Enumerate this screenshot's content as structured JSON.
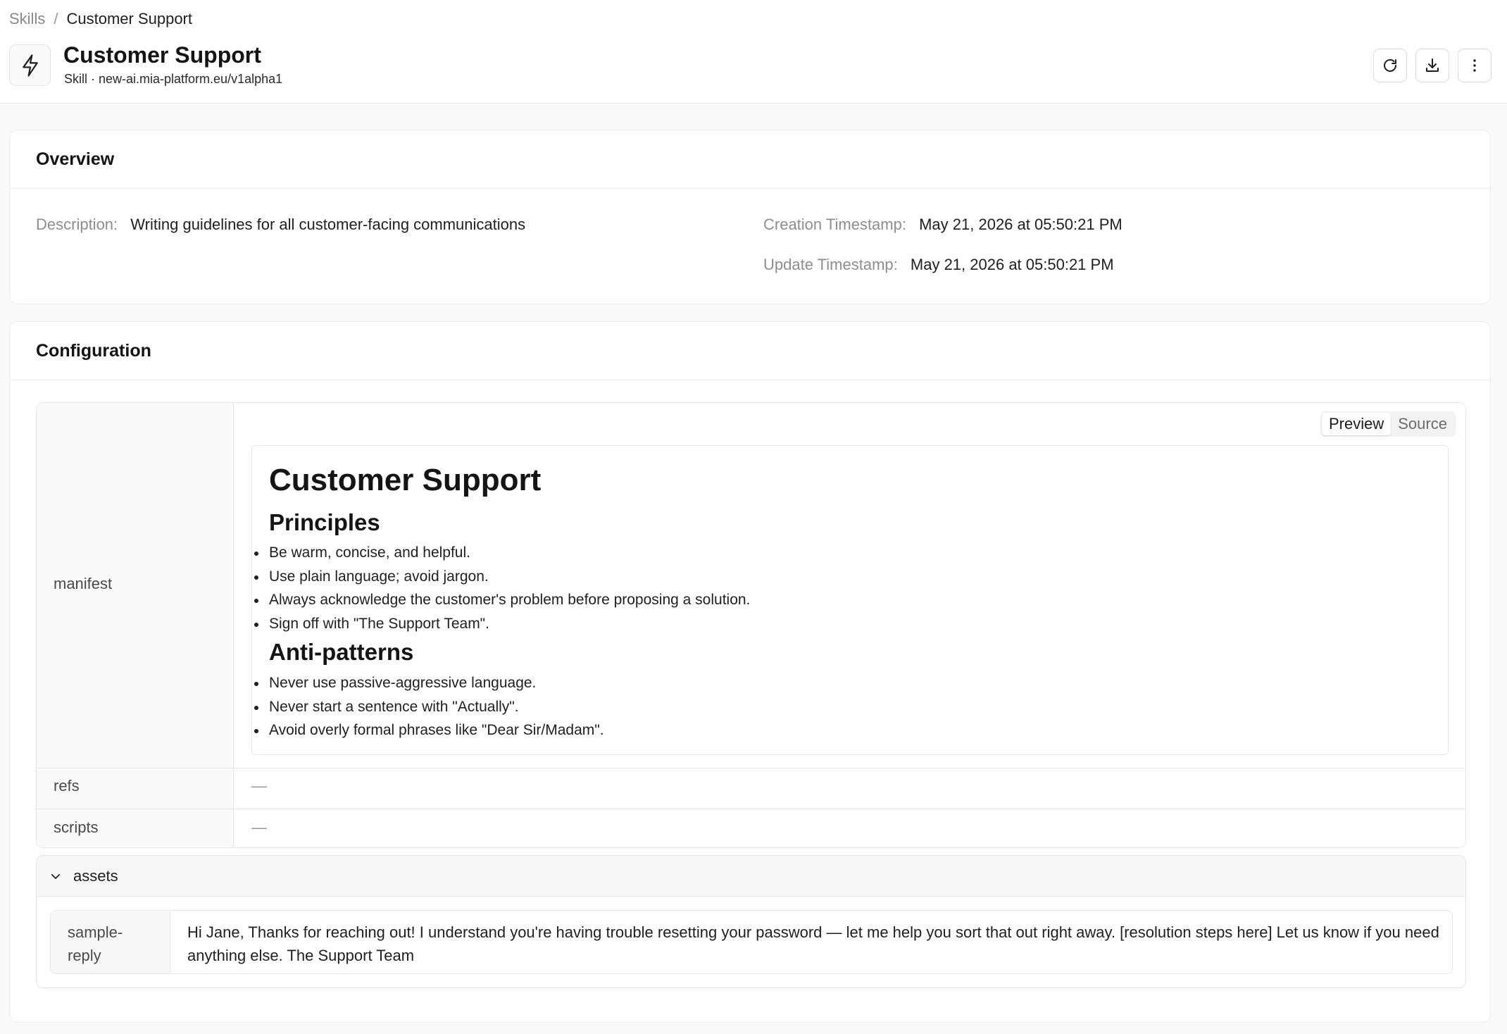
{
  "breadcrumb": {
    "root": "Skills",
    "separator": "/",
    "current": "Customer Support"
  },
  "header": {
    "icon": "lightning-bolt-icon",
    "title": "Customer Support",
    "subtitle": "Skill · new-ai.mia-platform.eu/v1alpha1",
    "actions": [
      "refresh-icon",
      "download-icon",
      "more-vertical-icon"
    ]
  },
  "overview": {
    "title": "Overview",
    "description_label": "Description",
    "description_value": "Writing guidelines for all customer-facing communications",
    "created_label": "Creation Timestamp",
    "created_value": "May 21, 2026 at 05:50:21 PM",
    "updated_label": "Update Timestamp",
    "updated_value": "May 21, 2026 at 05:50:21 PM"
  },
  "configuration": {
    "title": "Configuration",
    "rows": {
      "manifest": "manifest",
      "refs": "refs",
      "scripts": "scripts"
    },
    "empty_value": "—",
    "view_toggle": {
      "preview": "Preview",
      "source": "Source",
      "selected": "Preview"
    },
    "manifest_preview": {
      "h1": "Customer Support",
      "sections": [
        {
          "heading": "Principles",
          "items": [
            "Be warm, concise, and helpful.",
            "Use plain language; avoid jargon.",
            "Always acknowledge the customer's problem before proposing a solution.",
            "Sign off with \"The Support Team\"."
          ]
        },
        {
          "heading": "Anti-patterns",
          "items": [
            "Never use passive-aggressive language.",
            "Never start a sentence with \"Actually\".",
            "Avoid overly formal phrases like \"Dear Sir/Madam\"."
          ]
        }
      ]
    },
    "assets": {
      "label": "assets",
      "expanded": true,
      "items": [
        {
          "key": "sample-\nreply",
          "value": "Hi Jane, Thanks for reaching out! I understand you're having trouble resetting your password — let me help you sort that out right away. [resolution steps here] Let us know if you need anything else. The Support Team"
        }
      ]
    }
  }
}
